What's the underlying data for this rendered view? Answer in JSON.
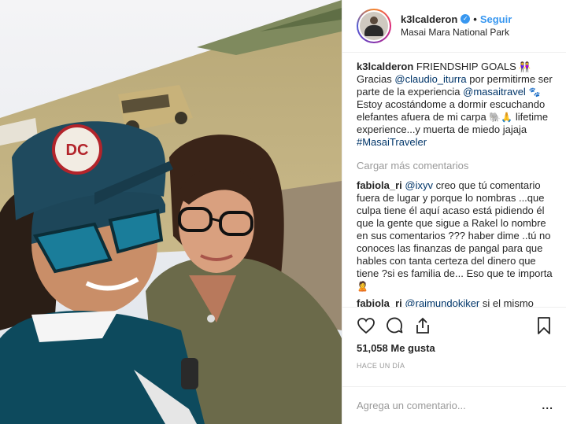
{
  "post": {
    "username": "k3lcalderon",
    "follow_label": "Seguir",
    "separator": "•",
    "location": "Masai Mara National Park"
  },
  "comments": [
    {
      "user": "k3lcalderon",
      "t1": " FRIENDSHIP GOALS ",
      "e1": "👭",
      "t2": "Gracias ",
      "m1": "@claudio_iturra",
      "t3": " por permitirme ser parte de la experiencia ",
      "m2": "@masaitravel",
      "e2": "🐾",
      "t4": " Estoy acostándome a dormir escuchando elefantes afuera de mi carpa ",
      "e3": "🐘🙏",
      "t5": " lifetime experience...y muerta de miedo jajaja ",
      "m3": "#MasaiTraveler"
    },
    {
      "user": "fabiola_ri",
      "m1": "@ixyv",
      "t1": " creo que tú comentario fuera de lugar y porque lo nombras ...que culpa tiene él aquí acaso está pidiendo él que la gente que sigue a Rakel lo nombre en sus comentarios ??? haber dime ..tú no conoces las finanzas de pangal para que hables con tanta certeza del dinero que tiene ?si es familia de... Eso que te importa ",
      "e1": "🙎"
    },
    {
      "user": "fabiola_ri",
      "m1": "@raimundokiker",
      "t1": " si el mismo excelente memoria"
    }
  ],
  "load_more": "Cargar más comentarios",
  "actions": {
    "likes": "51,058 Me gusta",
    "time_ago": "HACE UN DÍA"
  },
  "add_comment": {
    "placeholder": "Agrega un comentario...",
    "more": "..."
  },
  "icons": {
    "like": "heart-icon",
    "comment": "comment-icon",
    "share": "share-icon",
    "save": "bookmark-icon",
    "verified": "verified-badge-icon"
  },
  "colors": {
    "link": "#003569",
    "follow": "#3897f0",
    "muted": "#999999",
    "border": "#efefef"
  },
  "photo": {
    "cap_logo": "DC"
  }
}
